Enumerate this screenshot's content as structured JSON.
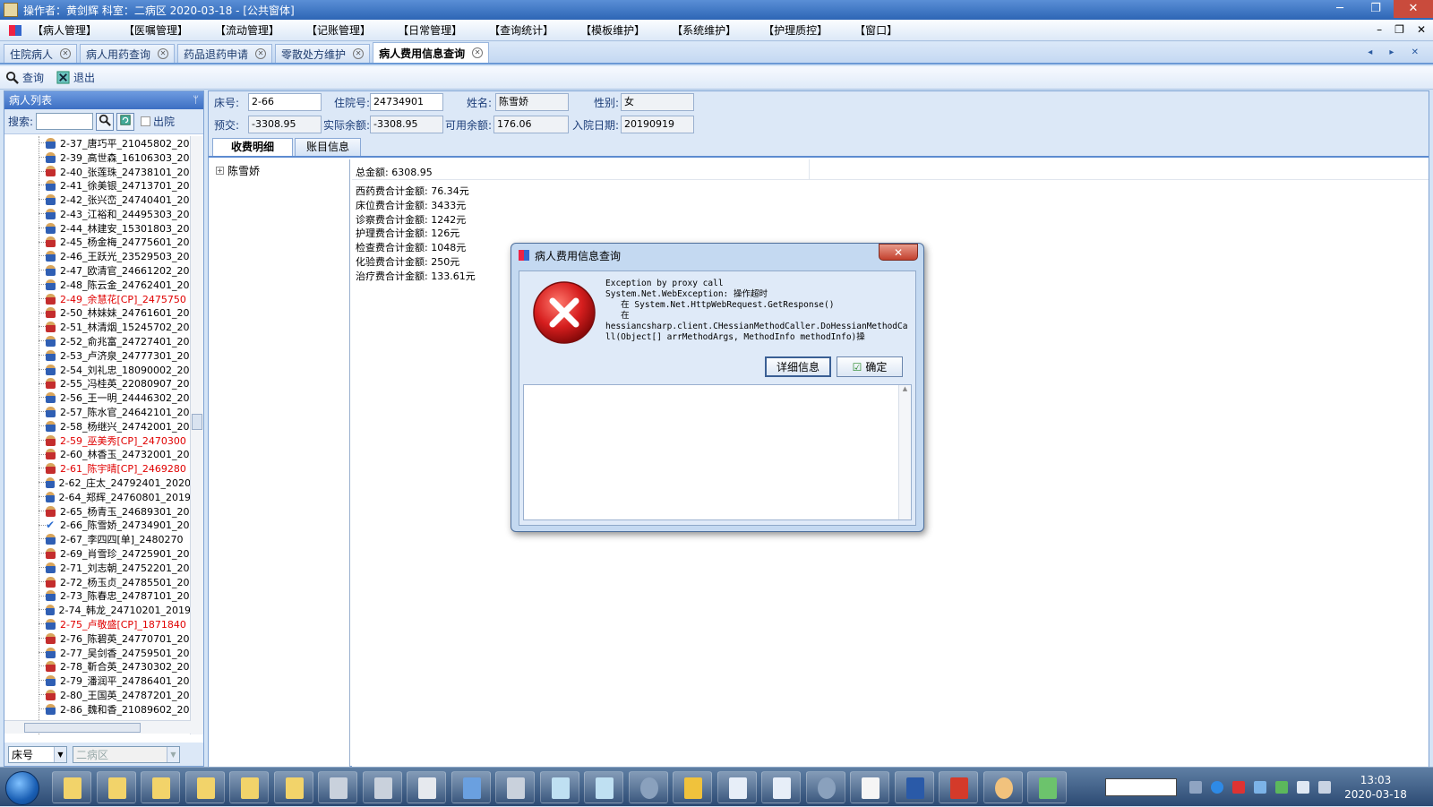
{
  "window": {
    "title": "操作者：黄剑辉  科室：二病区  2020-03-18   - [公共窗体]",
    "min": "─",
    "max": "❐",
    "close": "✕"
  },
  "menu": [
    "【病人管理】",
    "【医嘱管理】",
    "【流动管理】",
    "【记账管理】",
    "【日常管理】",
    "【查询统计】",
    "【模板维护】",
    "【系统维护】",
    "【护理质控】",
    "【窗口】"
  ],
  "mdi_buttons": [
    "–",
    "❐",
    "✕"
  ],
  "tabs": [
    {
      "label": "住院病人",
      "active": false
    },
    {
      "label": "病人用药查询",
      "active": false
    },
    {
      "label": "药品退药申请",
      "active": false
    },
    {
      "label": "零散处方维护",
      "active": false
    },
    {
      "label": "病人费用信息查询",
      "active": true
    }
  ],
  "tab_nav": "◂ ▸ ✕",
  "toolbar": {
    "query": "查询",
    "exit": "退出"
  },
  "patient_list": {
    "header": "病人列表",
    "pin": "ᛘ",
    "search_label": "搜索:",
    "discharged_label": "出院",
    "sort_value": "床号",
    "ward_value": "二病区",
    "patients": [
      {
        "text": "2-37_唐巧平_21045802_20",
        "sex": "m",
        "red": false
      },
      {
        "text": "2-39_高世森_16106303_20",
        "sex": "m",
        "red": false
      },
      {
        "text": "2-40_张莲珠_24738101_20",
        "sex": "f",
        "red": false
      },
      {
        "text": "2-41_徐美银_24713701_20",
        "sex": "m",
        "red": false
      },
      {
        "text": "2-42_张兴峦_24740401_20",
        "sex": "m",
        "red": false
      },
      {
        "text": "2-43_江裕和_24495303_20",
        "sex": "m",
        "red": false
      },
      {
        "text": "2-44_林建安_15301803_20",
        "sex": "m",
        "red": false
      },
      {
        "text": "2-45_杨金梅_24775601_20",
        "sex": "f",
        "red": false
      },
      {
        "text": "2-46_王跃光_23529503_20",
        "sex": "m",
        "red": false
      },
      {
        "text": "2-47_欧清官_24661202_20",
        "sex": "m",
        "red": false
      },
      {
        "text": "2-48_陈云金_24762401_20",
        "sex": "m",
        "red": false
      },
      {
        "text": "2-49_余慧花[CP]_2475750",
        "sex": "f",
        "red": true
      },
      {
        "text": "2-50_林妹妹_24761601_20",
        "sex": "f",
        "red": false
      },
      {
        "text": "2-51_林清烟_15245702_20",
        "sex": "f",
        "red": false
      },
      {
        "text": "2-52_俞兆富_24727401_20",
        "sex": "m",
        "red": false
      },
      {
        "text": "2-53_卢济泉_24777301_20",
        "sex": "m",
        "red": false
      },
      {
        "text": "2-54_刘礼忠_18090002_20",
        "sex": "m",
        "red": false
      },
      {
        "text": "2-55_冯桂英_22080907_20",
        "sex": "f",
        "red": false
      },
      {
        "text": "2-56_王一明_24446302_20",
        "sex": "m",
        "red": false
      },
      {
        "text": "2-57_陈水官_24642101_20",
        "sex": "m",
        "red": false
      },
      {
        "text": "2-58_杨继兴_24742001_20",
        "sex": "m",
        "red": false
      },
      {
        "text": "2-59_巫美秀[CP]_2470300",
        "sex": "f",
        "red": true
      },
      {
        "text": "2-60_林香玉_24732001_20",
        "sex": "f",
        "red": false
      },
      {
        "text": "2-61_陈宇晴[CP]_2469280",
        "sex": "f",
        "red": true
      },
      {
        "text": "2-62_庄太_24792401_2020",
        "sex": "m",
        "red": false
      },
      {
        "text": "2-64_郑辉_24760801_2019",
        "sex": "m",
        "red": false
      },
      {
        "text": "2-65_杨青玉_24689301_20",
        "sex": "f",
        "red": false
      },
      {
        "text": "2-66_陈雪娇_24734901_20",
        "sex": "check",
        "red": false
      },
      {
        "text": "2-67_李四四[单]_2480270",
        "sex": "m",
        "red": false
      },
      {
        "text": "2-69_肖雪珍_24725901_20",
        "sex": "f",
        "red": false
      },
      {
        "text": "2-71_刘志朝_24752201_20",
        "sex": "m",
        "red": false
      },
      {
        "text": "2-72_杨玉贞_24785501_20",
        "sex": "f",
        "red": false
      },
      {
        "text": "2-73_陈春忠_24787101_20",
        "sex": "m",
        "red": false
      },
      {
        "text": "2-74_韩龙_24710201_2019",
        "sex": "m",
        "red": false
      },
      {
        "text": "2-75_卢敬盛[CP]_1871840",
        "sex": "m",
        "red": true
      },
      {
        "text": "2-76_陈碧英_24770701_20",
        "sex": "f",
        "red": false
      },
      {
        "text": "2-77_吴剑香_24759501_20",
        "sex": "m",
        "red": false
      },
      {
        "text": "2-78_靳合英_24730302_20",
        "sex": "f",
        "red": false
      },
      {
        "text": "2-79_潘润平_24786401_20",
        "sex": "m",
        "red": false
      },
      {
        "text": "2-80_王国英_24787201_20",
        "sex": "f",
        "red": false
      },
      {
        "text": "2-86_魏和香_21089602_20",
        "sex": "m",
        "red": false
      }
    ]
  },
  "patient_info": {
    "bed_label": "床号:",
    "bed": "2-66",
    "inpatient_no_label": "住院号:",
    "inpatient_no": "24734901",
    "name_label": "姓名:",
    "name": "陈雪娇",
    "sex_label": "性别:",
    "sex": "女",
    "prepay_label": "预交:",
    "prepay": "-3308.95",
    "actual_balance_label": "实际余额:",
    "actual_balance": "-3308.95",
    "available_balance_label": "可用余额:",
    "available_balance": "176.06",
    "admit_date_label": "入院日期:",
    "admit_date": "20190919"
  },
  "subtabs": [
    "收费明细",
    "账目信息"
  ],
  "fee_tree_root": "陈雪娇",
  "fees": {
    "total": "总金额: 6308.95",
    "items": [
      "西药费合计金额: 76.34元",
      "床位费合计金额: 3433元",
      "诊察费合计金额: 1242元",
      "护理费合计金额: 126元",
      "检查费合计金额: 1048元",
      "化验费合计金额: 250元",
      "治疗费合计金额: 133.61元"
    ]
  },
  "dialog": {
    "title": "病人费用信息查询",
    "close": "✕",
    "message": "Exception by proxy call\nSystem.Net.WebException: 操作超时\n   在 System.Net.HttpWebRequest.GetResponse()\n   在\nhessiancsharp.client.CHessianMethodCaller.DoHessianMethodCall(Object[] arrMethodArgs, MethodInfo methodInfo)操",
    "details_button": "详细信息",
    "ok_button": "确定"
  },
  "taskbar": {
    "clock_time": "13:03",
    "clock_date": "2020-03-18",
    "items": [
      "folder",
      "folder",
      "folder",
      "folder",
      "folder",
      "folder",
      "drive",
      "drive",
      "printer",
      "monitor",
      "drive",
      "note",
      "note",
      "compass",
      "sql",
      "word",
      "word",
      "compass",
      "doctor",
      "sql-search",
      "app-red",
      "paint",
      "network"
    ]
  },
  "colors": {
    "accent": "#3c6fc3",
    "red_text": "#e00000",
    "panel_bg": "#dce8f7"
  }
}
